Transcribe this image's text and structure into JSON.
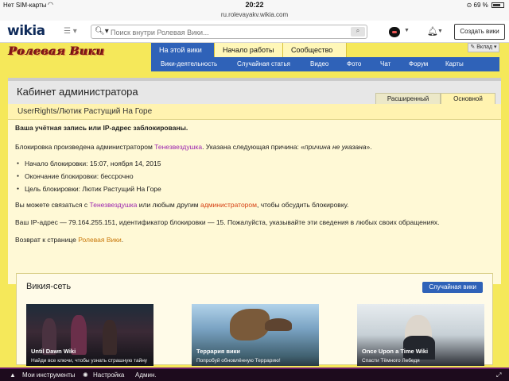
{
  "status_bar": {
    "carrier": "Нет SIM-карты",
    "time": "20:22",
    "battery": "69 %"
  },
  "url_bar": {
    "domain": "ru.rolevayakv.wikia.com"
  },
  "global_nav": {
    "logo": "wikia",
    "search_placeholder": "Поиск внутри Ролевая Вики...",
    "create_wiki_label": "Создать вики"
  },
  "wiki": {
    "logo_text": "Ролевая Вики",
    "tabs": [
      {
        "label": "На этой вики",
        "active": true
      },
      {
        "label": "Начало работы",
        "active": false
      },
      {
        "label": "Сообщество",
        "active": false
      }
    ],
    "subnav": [
      "Вики-деятельность",
      "Случайная статья",
      "Видео",
      "Фото",
      "Чат",
      "Форум",
      "Карты"
    ],
    "contribute_label": "Вклад"
  },
  "page": {
    "title": "Кабинет администратора",
    "tabs": [
      "Расширенный",
      "Основной"
    ],
    "subtitle": "UserRights/Лютик Растущий На Горе",
    "blocked_heading": "Ваша учётная запись или IP-адрес заблокированы.",
    "blocked_by_prefix": "Блокировка произведена администратором ",
    "blocked_by_user": "Тенезвездушка",
    "reason_prefix": ". Указана следующая причина: «",
    "reason": "причина не указана",
    "reason_suffix": "».",
    "details": [
      "Начало блокировки: 15:07, ноября 14, 2015",
      "Окончание блокировки: бессрочно",
      "Цель блокировки: Лютик Растущий На Горе"
    ],
    "contact_prefix": "Вы можете связаться с ",
    "contact_user": "Тенезвездушка",
    "contact_mid": " или любым другим ",
    "contact_admin": "администратором",
    "contact_suffix": ", чтобы обсудить блокировку.",
    "ip_text": "Ваш IP-адрес — 79.164.255.151, идентификатор блокировки — 15. Пожалуйста, указывайте эти сведения в любых своих обращениях.",
    "return_prefix": "Возврат к странице ",
    "return_link": "Ролевая Вики",
    "return_suffix": "."
  },
  "network": {
    "heading": "Викия-сеть",
    "random_label": "Случайная вики",
    "cards": [
      {
        "title": "Until Dawn Wiki",
        "subtitle": "Найди все ключи, чтобы узнать страшную тайну"
      },
      {
        "title": "Террария вики",
        "subtitle": "Попробуй обновлённую Террарию!"
      },
      {
        "title": "Once Upon a Time Wiki",
        "subtitle": "Спасти Тёмного Лебедя"
      }
    ]
  },
  "toolbar": {
    "my_tools": "Мои инструменты",
    "settings": "Настройка",
    "admin": "Админ."
  }
}
